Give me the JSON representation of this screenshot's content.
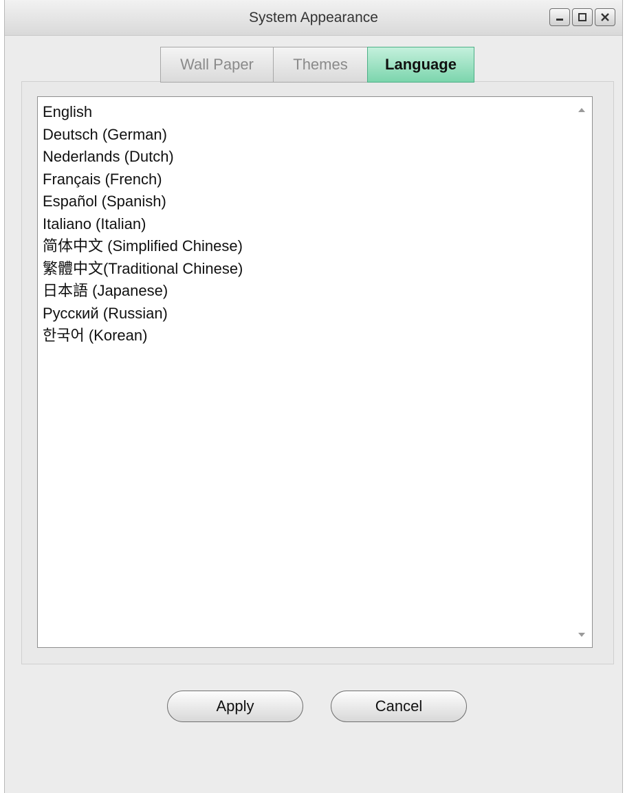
{
  "window": {
    "title": "System Appearance"
  },
  "window_controls": {
    "minimize_icon": "minimize-icon",
    "maximize_icon": "maximize-icon",
    "close_icon": "close-icon"
  },
  "tabs": [
    {
      "label": "Wall Paper",
      "active": false
    },
    {
      "label": "Themes",
      "active": false
    },
    {
      "label": "Language",
      "active": true
    }
  ],
  "languages": [
    "English",
    "Deutsch (German)",
    "Nederlands (Dutch)",
    "Français (French)",
    "Español (Spanish)",
    "Italiano (Italian)",
    "简体中文 (Simplified Chinese)",
    "繁體中文(Traditional Chinese)",
    "日本語 (Japanese)",
    "Русский (Russian)",
    "한국어 (Korean)"
  ],
  "buttons": {
    "apply_label": "Apply",
    "cancel_label": "Cancel"
  },
  "colors": {
    "active_tab_fill": "#7cd5ad",
    "active_tab_border": "#4cae86",
    "window_bg": "#ececec"
  }
}
